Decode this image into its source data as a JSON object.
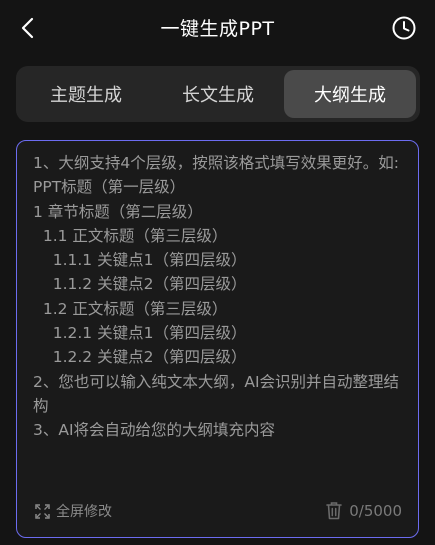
{
  "header": {
    "title": "一键生成PPT",
    "back_icon": "chevron-left-icon",
    "history_icon": "clock-icon"
  },
  "tabs": [
    {
      "label": "主题生成",
      "active": false
    },
    {
      "label": "长文生成",
      "active": false
    },
    {
      "label": "大纲生成",
      "active": true
    }
  ],
  "editor": {
    "placeholder": "1、大纲支持4个层级，按照该格式填写效果更好。如:\nPPT标题（第一层级）\n1 章节标题（第二层级）\n  1.1 正文标题（第三层级）\n    1.1.1 关键点1（第四层级）\n    1.1.2 关键点2（第四层级）\n  1.2 正文标题（第三层级）\n    1.2.1 关键点1（第四层级）\n    1.2.2 关键点2（第四层级）\n2、您也可以输入纯文本大纲，AI会识别并自动整理结构\n3、AI将会自动给您的大纲填充内容",
    "value": "",
    "fullscreen_label": "全屏修改",
    "char_count": "0/5000",
    "accent_color": "#6c6cf0"
  }
}
